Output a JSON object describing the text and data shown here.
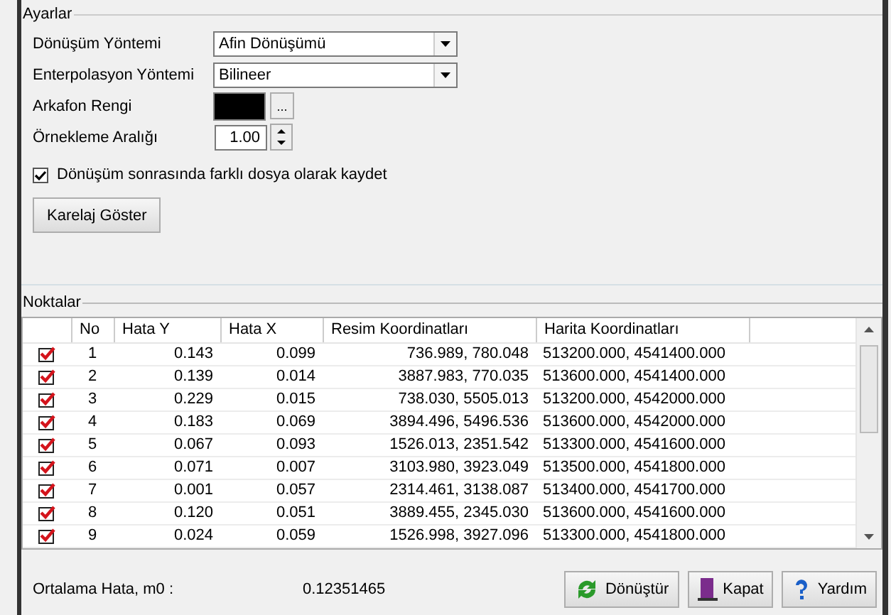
{
  "settings": {
    "title": "Ayarlar",
    "transform_method": {
      "label": "Dönüşüm Yöntemi",
      "value": "Afin Dönüşümü"
    },
    "interpolation_method": {
      "label": "Enterpolasyon Yöntemi",
      "value": "Bilineer"
    },
    "background_color": {
      "label": "Arkafon Rengi",
      "color": "#000000",
      "browse": "..."
    },
    "sampling_interval": {
      "label": "Örnekleme Aralığı",
      "value": "1.00"
    },
    "save_as_copy": {
      "label": "Dönüşüm sonrasında farklı dosya olarak kaydet",
      "checked": true
    },
    "grid_button": "Karelaj Göster"
  },
  "points": {
    "title": "Noktalar",
    "columns": [
      "No",
      "Hata Y",
      "Hata X",
      "Resim Koordinatları",
      "Harita Koordinatları"
    ],
    "rows": [
      {
        "checked": true,
        "cells": [
          "1",
          "0.143",
          "0.099",
          "736.989, 780.048",
          "513200.000, 4541400.000"
        ]
      },
      {
        "checked": true,
        "cells": [
          "2",
          "0.139",
          "0.014",
          "3887.983, 770.035",
          "513600.000, 4541400.000"
        ]
      },
      {
        "checked": true,
        "cells": [
          "3",
          "0.229",
          "0.015",
          "738.030, 5505.013",
          "513200.000, 4542000.000"
        ]
      },
      {
        "checked": true,
        "cells": [
          "4",
          "0.183",
          "0.069",
          "3894.496, 5496.536",
          "513600.000, 4542000.000"
        ]
      },
      {
        "checked": true,
        "cells": [
          "5",
          "0.067",
          "0.093",
          "1526.013, 2351.542",
          "513300.000, 4541600.000"
        ]
      },
      {
        "checked": true,
        "cells": [
          "6",
          "0.071",
          "0.007",
          "3103.980, 3923.049",
          "513500.000, 4541800.000"
        ]
      },
      {
        "checked": true,
        "cells": [
          "7",
          "0.001",
          "0.057",
          "2314.461, 3138.087",
          "513400.000, 4541700.000"
        ]
      },
      {
        "checked": true,
        "cells": [
          "8",
          "0.120",
          "0.051",
          "3889.455, 2345.030",
          "513600.000, 4541600.000"
        ]
      },
      {
        "checked": true,
        "cells": [
          "9",
          "0.024",
          "0.059",
          "1526.998, 3927.096",
          "513300.000, 4541800.000"
        ]
      }
    ]
  },
  "footer": {
    "rms_label": "Ortalama Hata, m0 :",
    "rms_value": "0.12351465",
    "buttons": [
      {
        "kind": "convert",
        "label": "Dönüştür"
      },
      {
        "kind": "close",
        "label": "Kapat"
      },
      {
        "kind": "help",
        "label": "Yardım"
      }
    ]
  }
}
